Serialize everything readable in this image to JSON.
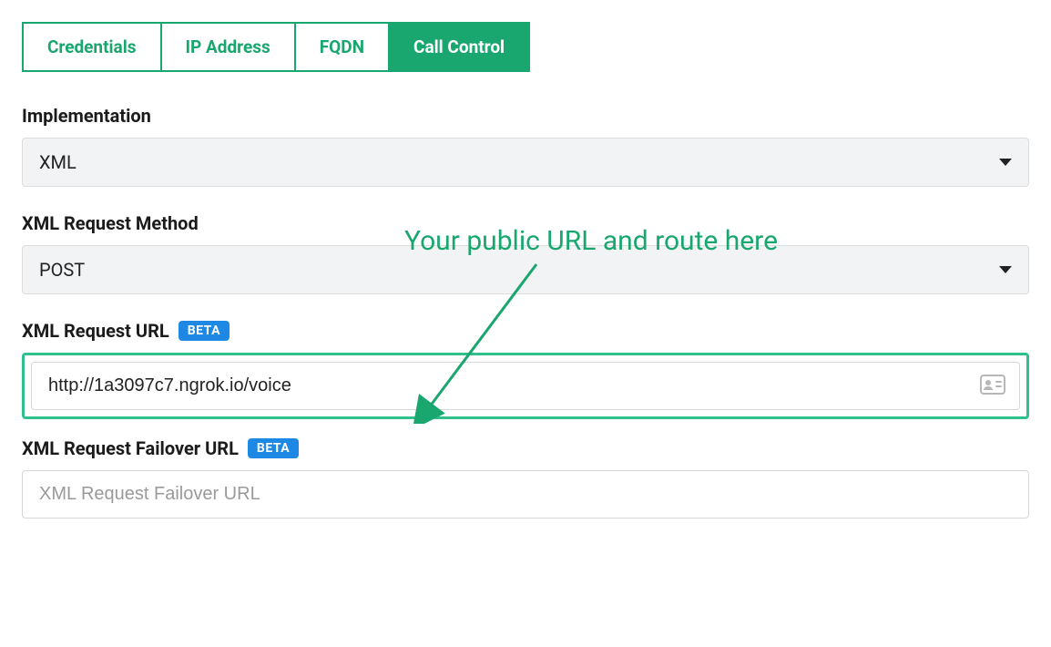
{
  "tabs": [
    {
      "label": "Credentials",
      "active": false
    },
    {
      "label": "IP Address",
      "active": false
    },
    {
      "label": "FQDN",
      "active": false
    },
    {
      "label": "Call Control",
      "active": true
    }
  ],
  "fields": {
    "implementation": {
      "label": "Implementation",
      "value": "XML"
    },
    "method": {
      "label": "XML Request Method",
      "value": "POST"
    },
    "requestUrl": {
      "label": "XML Request URL",
      "badge": "BETA",
      "value": "http://1a3097c7.ngrok.io/voice"
    },
    "failoverUrl": {
      "label": "XML Request Failover URL",
      "badge": "BETA",
      "placeholder": "XML Request Failover URL",
      "value": ""
    }
  },
  "annotation": {
    "text": "Your public URL and route here"
  },
  "colors": {
    "accent": "#1aa66f",
    "badge": "#1e88e5",
    "highlight": "#30c08c"
  }
}
